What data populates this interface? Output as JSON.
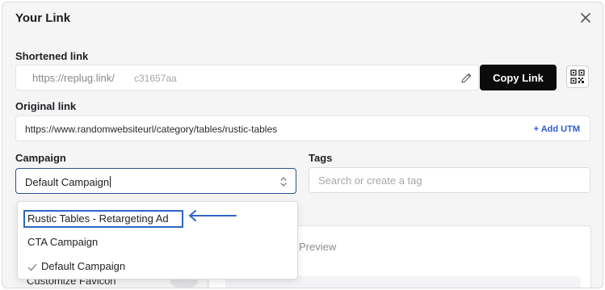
{
  "dialog": {
    "title": "Your Link",
    "close_icon": "close-icon"
  },
  "shortened": {
    "label": "Shortened link",
    "prefix": "https://replug.link/",
    "code": "c31657aa",
    "edit_icon": "pencil-icon",
    "copy_label": "Copy Link",
    "qr_icon": "qr-code-icon"
  },
  "original": {
    "label": "Original link",
    "url": "https://www.randomwebsiteurl/category/tables/rustic-tables",
    "add_utm_label": "+ Add UTM"
  },
  "campaign": {
    "label": "Campaign",
    "value": "Default Campaign",
    "options": [
      {
        "label": "Rustic Tables - Retargeting Ad",
        "highlighted": true
      },
      {
        "label": "CTA Campaign"
      },
      {
        "label": "Default Campaign",
        "selected": true
      }
    ]
  },
  "tags": {
    "label": "Tags",
    "placeholder": "Search or create a tag"
  },
  "preview": {
    "label": "Preview"
  },
  "favicon": {
    "label": "Customize Favicon"
  },
  "colors": {
    "accent": "#2f66c7",
    "primary_button": "#0b0b0c",
    "link": "#2d5bd1"
  }
}
